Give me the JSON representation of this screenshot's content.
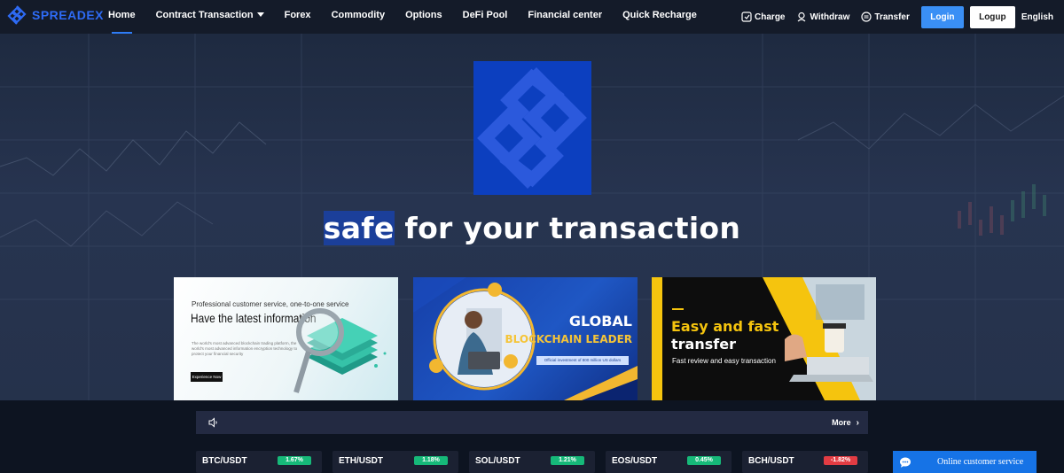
{
  "brand": {
    "name": "SPREADEX"
  },
  "nav": {
    "links": [
      {
        "label": "Home",
        "active": true
      },
      {
        "label": "Contract Transaction",
        "dropdown": true
      },
      {
        "label": "Forex"
      },
      {
        "label": "Commodity"
      },
      {
        "label": "Options"
      },
      {
        "label": "DeFi Pool"
      },
      {
        "label": "Financial center"
      },
      {
        "label": "Quick Recharge"
      }
    ],
    "actions": [
      {
        "label": "Charge",
        "icon": "charge-icon"
      },
      {
        "label": "Withdraw",
        "icon": "withdraw-icon"
      },
      {
        "label": "Transfer",
        "icon": "transfer-icon"
      }
    ],
    "login_label": "Login",
    "logup_label": "Logup",
    "language": "English"
  },
  "hero": {
    "tagline_highlight": "safe",
    "tagline_rest": " for your transaction"
  },
  "banners": [
    {
      "small": "Professional customer service, one-to-one service",
      "big": "Have the latest information",
      "desc": "The world's most advanced blockchain trading platform, the world's most advanced information encryption technology to protect your financial security",
      "button": "Experience Now"
    },
    {
      "title1": "GLOBAL",
      "title2": "BLOCKCHAIN LEADER",
      "pill": "Official investment of 800 million US dollars"
    },
    {
      "title1": "Easy and fast",
      "title2": "transfer",
      "sub": "Fast review and easy transaction"
    }
  ],
  "notice": {
    "more_label": "More"
  },
  "tickers": [
    {
      "symbol": "BTC/USDT",
      "change": "1.67%",
      "direction": "up"
    },
    {
      "symbol": "ETH/USDT",
      "change": "1.18%",
      "direction": "up"
    },
    {
      "symbol": "SOL/USDT",
      "change": "1.21%",
      "direction": "up"
    },
    {
      "symbol": "EOS/USDT",
      "change": "0.45%",
      "direction": "up"
    },
    {
      "symbol": "BCH/USDT",
      "change": "-1.82%",
      "direction": "down"
    }
  ],
  "colors": {
    "accent": "#3a8ff5",
    "up": "#16b979",
    "down": "#e23c43",
    "brand": "#2e6bf5"
  },
  "chat": {
    "label": "Online customer service"
  }
}
